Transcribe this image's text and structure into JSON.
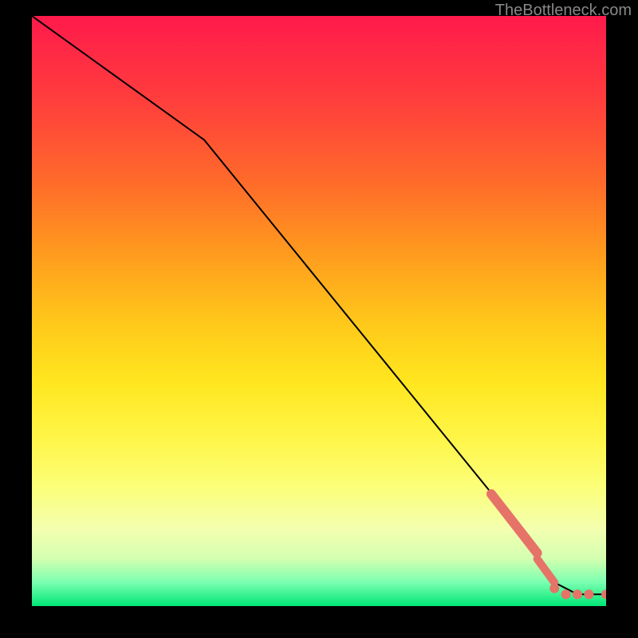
{
  "watermark": "TheBottleneck.com",
  "chart_data": {
    "type": "line",
    "title": "",
    "xlabel": "",
    "ylabel": "",
    "xlim": [
      0,
      100
    ],
    "ylim": [
      0,
      100
    ],
    "line": {
      "x": [
        0,
        30,
        86,
        91,
        95,
        100
      ],
      "y": [
        100,
        79,
        12,
        4,
        2,
        2
      ],
      "color": "#000000"
    },
    "marker_segments": [
      {
        "x0": 80,
        "y0": 19,
        "x1": 88,
        "y1": 9,
        "radius": 6,
        "color": "#e57368"
      },
      {
        "x0": 88,
        "y0": 8,
        "x1": 91,
        "y1": 4,
        "radius": 5,
        "color": "#e57368"
      }
    ],
    "markers": {
      "x": [
        91,
        93,
        95,
        97,
        100
      ],
      "y": [
        3,
        2,
        2,
        2,
        2
      ],
      "color": "#e57368",
      "radius": 6
    }
  }
}
